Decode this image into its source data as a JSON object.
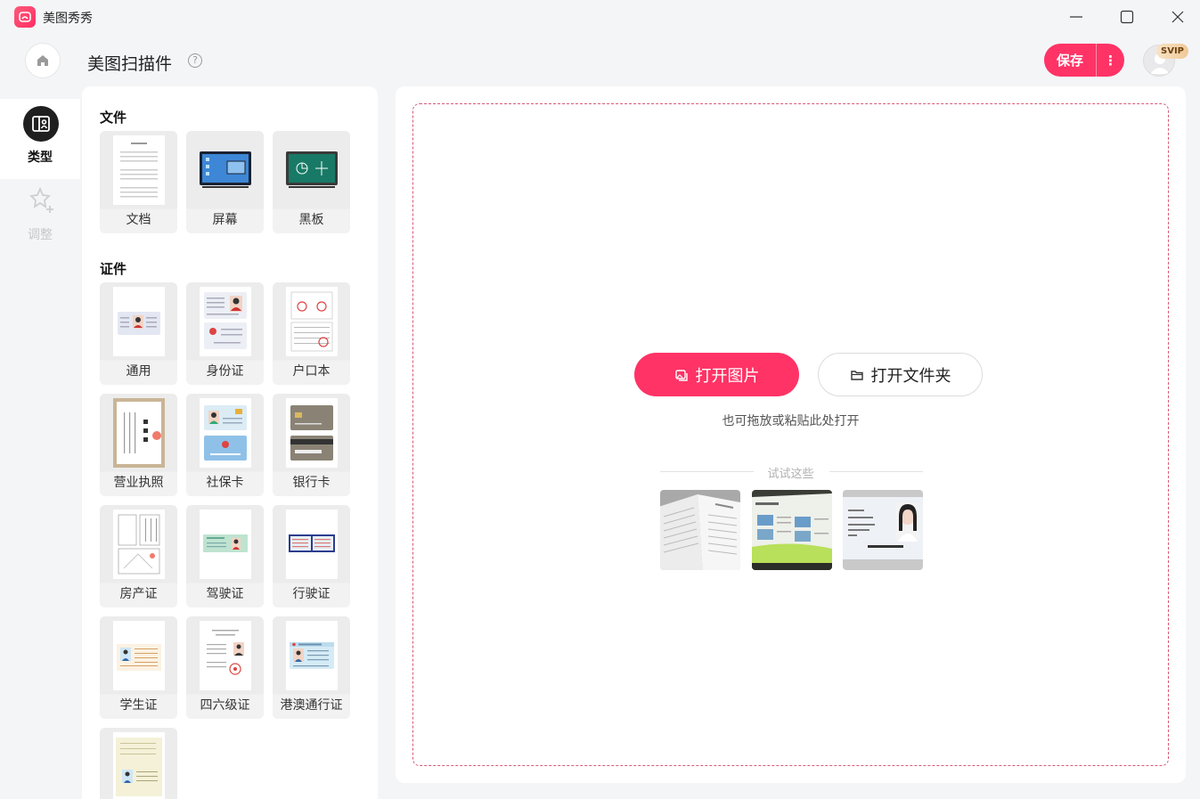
{
  "app": {
    "name": "美图秀秀",
    "logo_icon": "meitu-logo-icon",
    "brand_color": "#ff3366"
  },
  "window_controls": [
    "minimize-icon",
    "maximize-icon",
    "close-icon"
  ],
  "header": {
    "title": "美图扫描件",
    "help_glyph": "?",
    "save_label": "保存",
    "more_glyph": "⋮",
    "badge": "SVIP"
  },
  "nav": {
    "items": [
      {
        "label": "类型",
        "icon": "type-icon",
        "active": true
      },
      {
        "label": "调整",
        "icon": "adjust-icon",
        "active": false
      }
    ]
  },
  "panel": {
    "sections": [
      {
        "title": "文件",
        "items": [
          "文档",
          "屏幕",
          "黑板"
        ]
      },
      {
        "title": "证件",
        "items": [
          "通用",
          "身份证",
          "户口本",
          "营业执照",
          "社保卡",
          "银行卡",
          "房产证",
          "驾驶证",
          "行驶证",
          "学生证",
          "四六级证",
          "港澳通行证",
          ""
        ]
      }
    ]
  },
  "main": {
    "open_image_label": "打开图片",
    "open_folder_label": "打开文件夹",
    "hint": "也可拖放或粘贴此处打开",
    "try_label": "试试这些",
    "samples": [
      "sample-book-page",
      "sample-slide-screen",
      "sample-id-card"
    ]
  }
}
